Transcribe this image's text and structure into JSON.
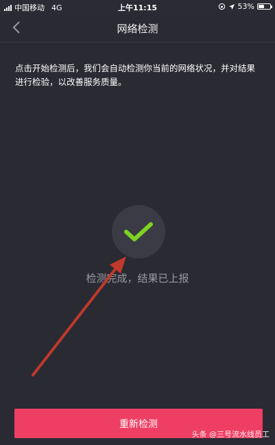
{
  "status_bar": {
    "carrier": "中国移动",
    "network": "4G",
    "time": "上午11:15",
    "battery_percent": "53%",
    "battery_level": 0.53
  },
  "nav": {
    "title": "网络检测"
  },
  "main": {
    "description": "点击开始检测后，我们会自动检测你当前的网络状况，并对结果进行检验，以改善服务质量。",
    "result_text": "检测完成，结果已上报"
  },
  "footer": {
    "retest_label": "重新检测"
  },
  "watermark": {
    "text": "头条 @三号流水线员工"
  },
  "colors": {
    "background": "#2a2a33",
    "accent_button": "#ef3e63",
    "check_green": "#7ed321",
    "annotation_arrow": "#c0392b"
  },
  "icons": {
    "back": "chevron-left-icon",
    "check": "checkmark-icon",
    "location": "location-arrow-icon",
    "lock": "rotation-lock-icon"
  }
}
